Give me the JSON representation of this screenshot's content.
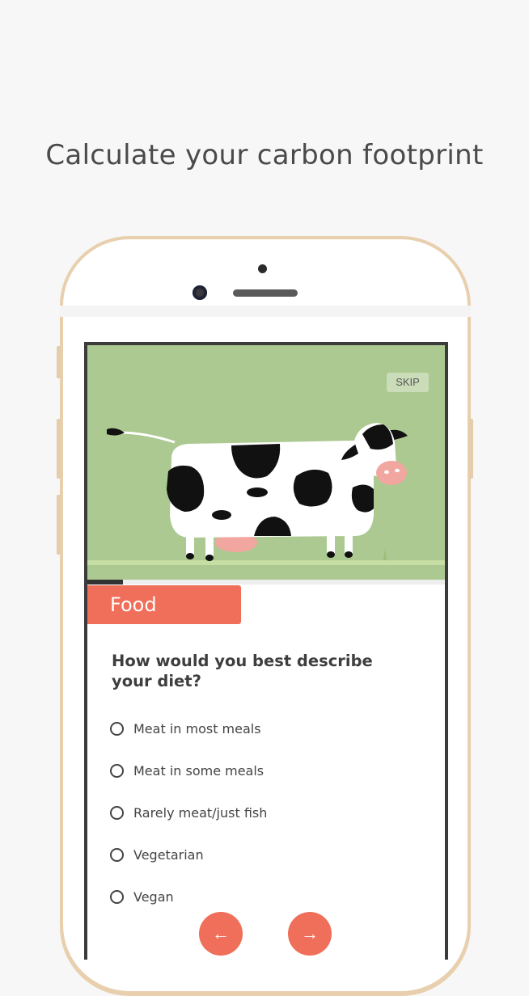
{
  "headline": "Calculate your carbon footprint",
  "screen": {
    "skip_label": "SKIP",
    "progress_fraction": 0.1,
    "category": "Food",
    "question": "How would you best describe your diet?",
    "options": [
      {
        "label": "Meat in most meals",
        "selected": false
      },
      {
        "label": "Meat in some meals",
        "selected": false
      },
      {
        "label": "Rarely meat/just fish",
        "selected": false
      },
      {
        "label": "Vegetarian",
        "selected": false
      },
      {
        "label": "Vegan",
        "selected": false
      }
    ],
    "back_icon": "←",
    "next_icon": "→"
  },
  "colors": {
    "accent": "#ef6f5a",
    "hero_bg": "#abc990",
    "phone_gold": "#e8cfae"
  }
}
